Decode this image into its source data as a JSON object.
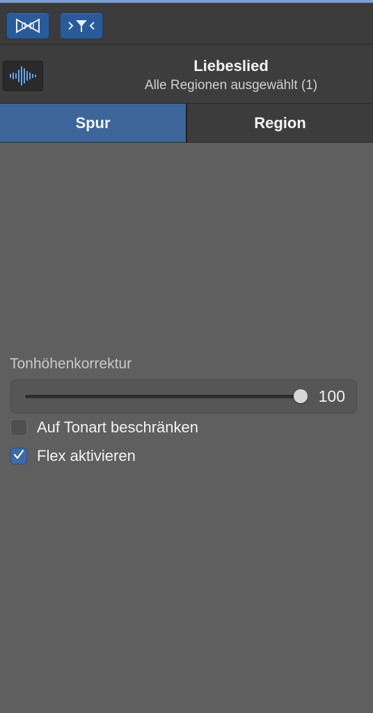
{
  "colors": {
    "accent": "#3d659a",
    "panel_bg": "#5f5f5f",
    "header_bg": "#3d3d3d",
    "toolbar_bg": "#3b3b3b",
    "button_blue": "#2b5a9a"
  },
  "toolbar": {
    "buttons": [
      {
        "icon": "smart-controls-icon"
      },
      {
        "icon": "filter-icon"
      }
    ]
  },
  "header": {
    "icon": "audio-waveform-icon",
    "title": "Liebeslied",
    "subtitle": "Alle Regionen ausgewählt (1)"
  },
  "tabs": [
    {
      "label": "Spur",
      "active": true
    },
    {
      "label": "Region",
      "active": false
    }
  ],
  "pitch_correction": {
    "label": "Tonhöhenkorrektur",
    "value": "100",
    "level": 1.0
  },
  "options": {
    "restrict_to_key": {
      "label": "Auf Tonart beschränken",
      "checked": false
    },
    "enable_flex": {
      "label": "Flex aktivieren",
      "checked": true
    }
  }
}
